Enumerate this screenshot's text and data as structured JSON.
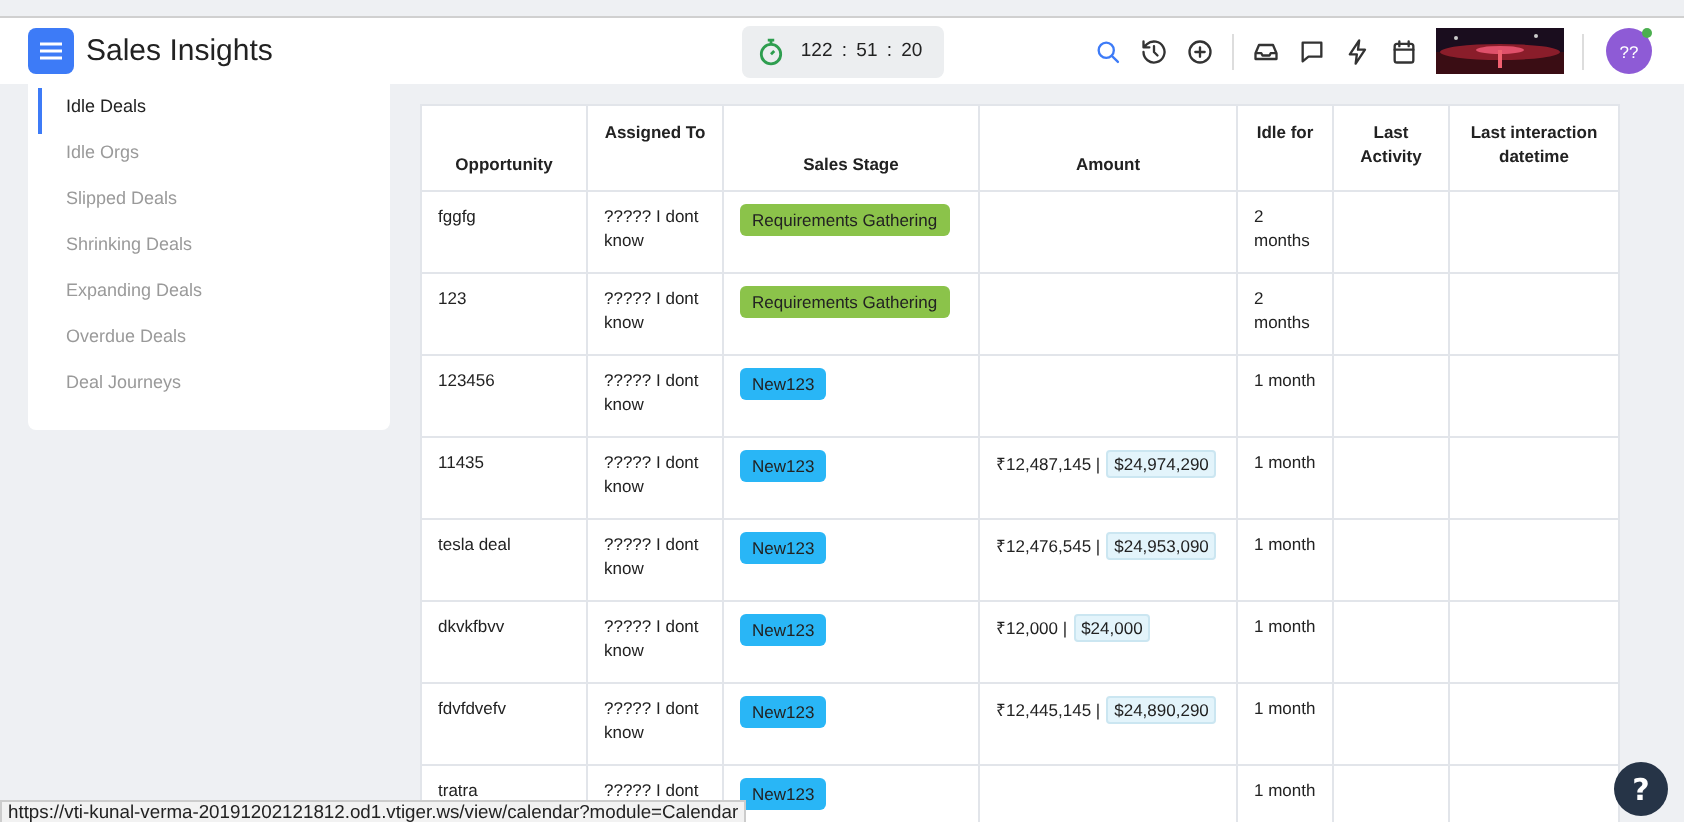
{
  "header": {
    "title": "Sales Insights",
    "timer": "122 : 51 : 20",
    "avatar": "??"
  },
  "sidebar": {
    "items": [
      {
        "label": "Idle Deals",
        "selected": true
      },
      {
        "label": "Idle Orgs",
        "selected": false
      },
      {
        "label": "Slipped Deals",
        "selected": false
      },
      {
        "label": "Shrinking Deals",
        "selected": false
      },
      {
        "label": "Expanding Deals",
        "selected": false
      },
      {
        "label": "Overdue Deals",
        "selected": false
      },
      {
        "label": "Deal Journeys",
        "selected": false
      }
    ]
  },
  "table": {
    "columns": [
      "Opportunity",
      "Assigned To",
      "Sales Stage",
      "Amount",
      "Idle for",
      "Last Activity",
      "Last interaction datetime"
    ],
    "rows": [
      {
        "opportunity": "fggfg",
        "assigned_to": "????? I dont know",
        "stage": {
          "label": "Requirements Gathering",
          "color": "#8bc34a"
        },
        "idle_for": "2 months"
      },
      {
        "opportunity": "123",
        "assigned_to": "????? I dont know",
        "stage": {
          "label": "Requirements Gathering",
          "color": "#8bc34a"
        },
        "idle_for": "2 months"
      },
      {
        "opportunity": "123456",
        "assigned_to": "????? I dont know",
        "stage": {
          "label": "New123",
          "color": "#29b6f6"
        },
        "idle_for": "1 month"
      },
      {
        "opportunity": "11435",
        "assigned_to": "????? I dont know",
        "stage": {
          "label": "New123",
          "color": "#29b6f6"
        },
        "amount": {
          "inr": "₹12,487,145 |",
          "usd": "$24,974,290"
        },
        "idle_for": "1 month"
      },
      {
        "opportunity": "tesla deal",
        "assigned_to": "????? I dont know",
        "stage": {
          "label": "New123",
          "color": "#29b6f6"
        },
        "amount": {
          "inr": "₹12,476,545 |",
          "usd": "$24,953,090"
        },
        "idle_for": "1 month"
      },
      {
        "opportunity": "dkvkfbvv",
        "assigned_to": "????? I dont know",
        "stage": {
          "label": "New123",
          "color": "#29b6f6"
        },
        "amount": {
          "inr": "₹12,000 |",
          "usd": "$24,000"
        },
        "idle_for": "1 month"
      },
      {
        "opportunity": "fdvfdvefv",
        "assigned_to": "????? I dont know",
        "stage": {
          "label": "New123",
          "color": "#29b6f6"
        },
        "amount": {
          "inr": "₹12,445,145 |",
          "usd": "$24,890,290"
        },
        "idle_for": "1 month"
      },
      {
        "opportunity": "tratra",
        "assigned_to": "????? I dont",
        "stage": {
          "label": "New123",
          "color": "#29b6f6"
        },
        "idle_for": "1 month"
      }
    ]
  },
  "status_bar": {
    "url": "https://vti-kunal-verma-20191202121812.od1.vtiger.ws/view/calendar?module=Calendar"
  },
  "help_button": "?"
}
